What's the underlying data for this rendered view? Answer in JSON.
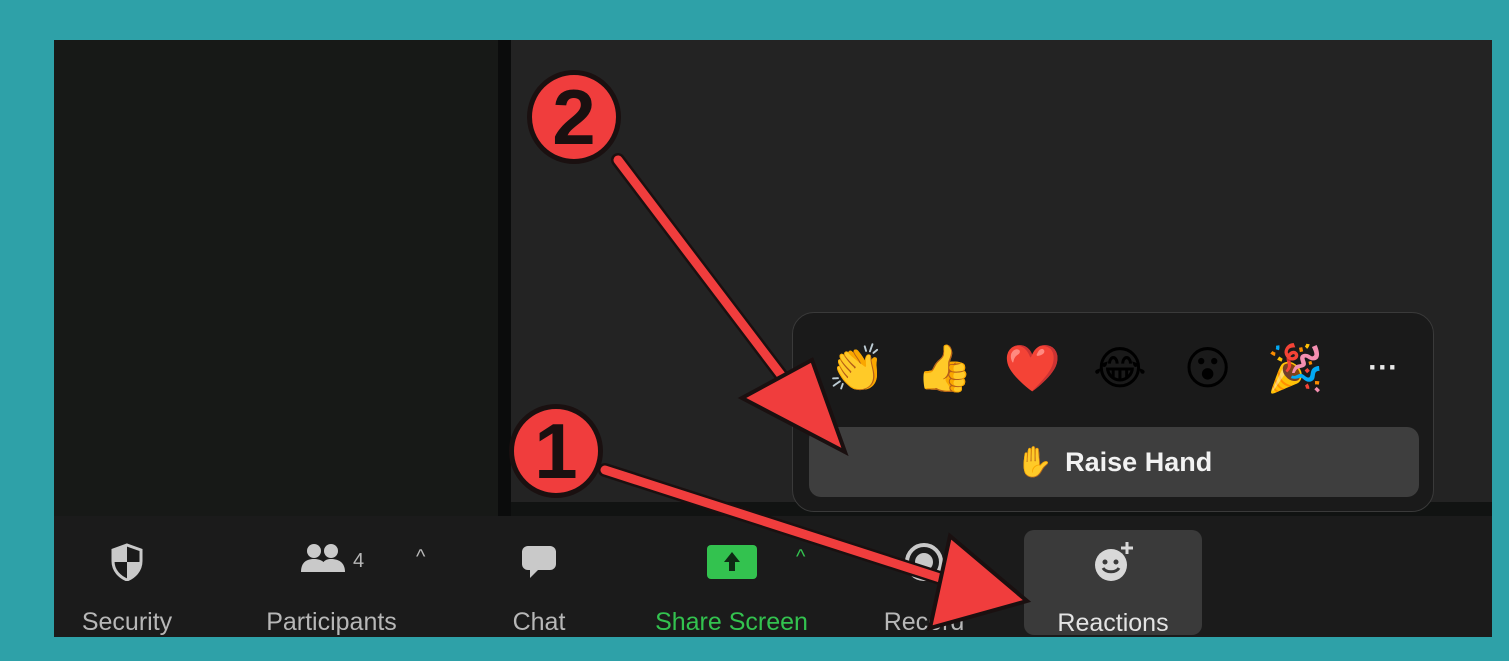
{
  "toolbar": {
    "security_label": "Security",
    "participants_label": "Participants",
    "participants_count": "4",
    "chat_label": "Chat",
    "share_label": "Share Screen",
    "record_label": "Record",
    "reactions_label": "Reactions"
  },
  "reactions_popup": {
    "emojis": [
      "👏",
      "👍",
      "❤️",
      "😂",
      "😮",
      "🎉"
    ],
    "more_label": "···",
    "raise_hand_emoji": "✋",
    "raise_hand_label": "Raise Hand"
  },
  "annotations": {
    "marker_1": "1",
    "marker_2": "2"
  },
  "colors": {
    "background": "#2ea1a8",
    "share_green": "#33c24f",
    "annotation_red": "#f03d3d"
  }
}
